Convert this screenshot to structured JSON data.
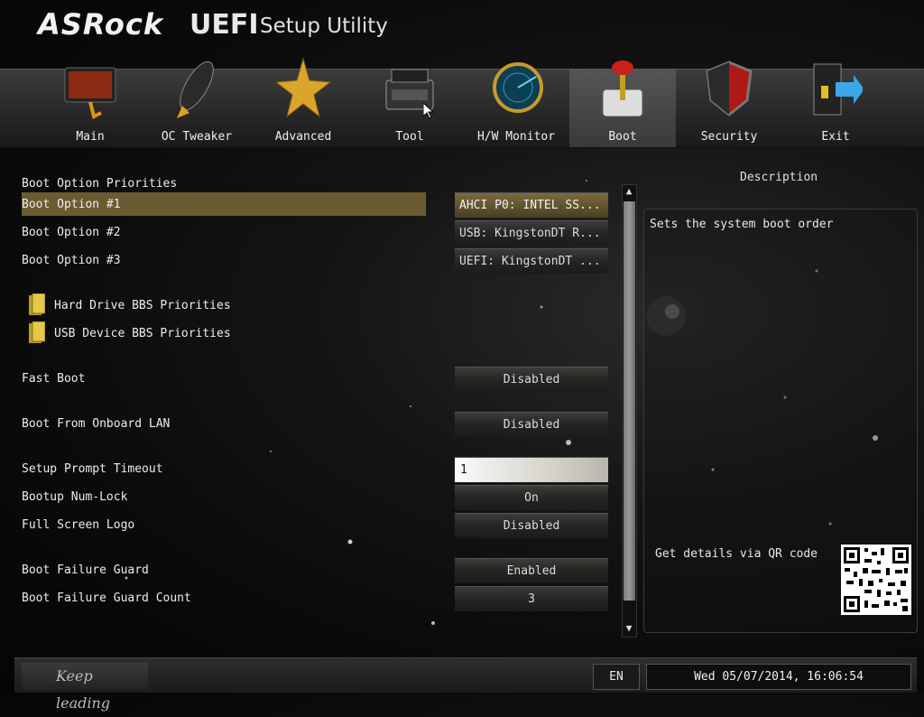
{
  "header": {
    "brand": "ASRock",
    "uefi": "UEFI",
    "subtitle": "Setup Utility"
  },
  "nav": {
    "active": "Boot",
    "tabs": [
      {
        "label": "Main",
        "icon": "monitor-icon"
      },
      {
        "label": "OC Tweaker",
        "icon": "rocket-icon"
      },
      {
        "label": "Advanced",
        "icon": "star-icon"
      },
      {
        "label": "Tool",
        "icon": "toolbox-icon"
      },
      {
        "label": "H/W Monitor",
        "icon": "radar-icon"
      },
      {
        "label": "Boot",
        "icon": "joystick-icon"
      },
      {
        "label": "Security",
        "icon": "shield-icon"
      },
      {
        "label": "Exit",
        "icon": "exit-door-icon"
      }
    ]
  },
  "settings": {
    "section_title": "Boot Option Priorities",
    "boot_option_1": {
      "label": "Boot Option #1",
      "value": "AHCI P0: INTEL SS..."
    },
    "boot_option_2": {
      "label": "Boot Option #2",
      "value": "USB: KingstonDT R..."
    },
    "boot_option_3": {
      "label": "Boot Option #3",
      "value": "UEFI: KingstonDT ..."
    },
    "hdd_bbs": "Hard Drive BBS Priorities",
    "usb_bbs": "USB Device BBS Priorities",
    "fast_boot": {
      "label": "Fast Boot",
      "value": "Disabled"
    },
    "onboard_lan": {
      "label": "Boot From Onboard LAN",
      "value": "Disabled"
    },
    "prompt_timeout": {
      "label": "Setup Prompt Timeout",
      "value": "1"
    },
    "numlock": {
      "label": "Bootup Num-Lock",
      "value": "On"
    },
    "full_logo": {
      "label": "Full Screen Logo",
      "value": "Disabled"
    },
    "fail_guard": {
      "label": "Boot Failure Guard",
      "value": "Enabled"
    },
    "fail_guard_count": {
      "label": "Boot Failure Guard Count",
      "value": "3"
    }
  },
  "description": {
    "title": "Description",
    "text": "Sets the system boot order",
    "qr_label": "Get details via QR code"
  },
  "footer": {
    "slogan": "Keep leading",
    "language": "EN",
    "datetime": "Wed 05/07/2014, 16:06:54"
  },
  "colors": {
    "highlight": "#6b5b33",
    "background": "#0a0a0a"
  }
}
